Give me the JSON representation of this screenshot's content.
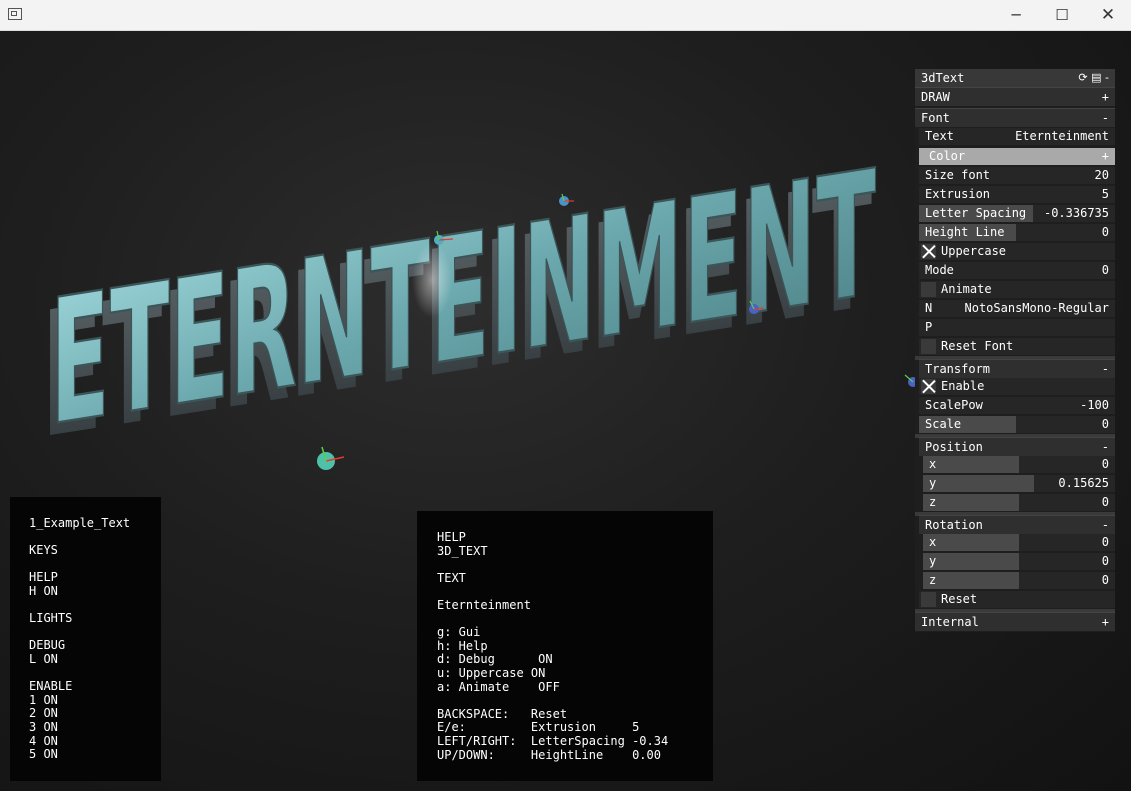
{
  "window": {
    "minimize_glyph": "─",
    "maximize_glyph": "☐",
    "close_glyph": "✕"
  },
  "left_panel": {
    "lines": [
      "1_Example_Text",
      "",
      "KEYS",
      "",
      "HELP",
      "H ON",
      "",
      "LIGHTS",
      "",
      "DEBUG",
      "L ON",
      "",
      "ENABLE",
      "1 ON",
      "2 ON",
      "3 ON",
      "4 ON",
      "5 ON"
    ]
  },
  "help_panel": {
    "lines": [
      "HELP",
      "3D_TEXT",
      "",
      "TEXT",
      "",
      "Eternteinment",
      "",
      "g: Gui",
      "h: Help",
      "d: Debug      ON",
      "u: Uppercase ON",
      "a: Animate    OFF",
      "",
      "BACKSPACE:   Reset",
      "E/e:         Extrusion     5",
      "LEFT/RIGHT:  LetterSpacing -0.34",
      "UP/DOWN:     HeightLine    0.00"
    ]
  },
  "scene": {
    "text_3d": "ETERNTEINMENT",
    "text_color": "#7ec0c4"
  },
  "gui": {
    "title": "3dText",
    "title_icons": "⟳ ▤ -",
    "draw": {
      "label": "DRAW",
      "toggle": "+"
    },
    "font": {
      "label": "Font",
      "toggle": "-",
      "text_label": "Text",
      "text_value": "Eternteinment",
      "color_label": "Color",
      "color_toggle": "+",
      "size_label": "Size font",
      "size_value": "20",
      "extrusion_label": "Extrusion",
      "extrusion_value": "5",
      "spacing_label": "Letter Spacing",
      "spacing_value": "-0.336735",
      "height_label": "Height Line",
      "height_value": "0",
      "uppercase_label": "Uppercase",
      "mode_label": "Mode",
      "mode_value": "0",
      "animate_label": "Animate",
      "n_label": "N",
      "n_value": "NotoSansMono-Regular",
      "p_label": "P",
      "reset_label": "Reset Font"
    },
    "transform": {
      "label": "Transform",
      "toggle": "-",
      "enable_label": "Enable",
      "scalepow_label": "ScalePow",
      "scalepow_value": "-100",
      "scale_label": "Scale",
      "scale_value": "0"
    },
    "position": {
      "label": "Position",
      "toggle": "-",
      "x_label": "x",
      "x_value": "0",
      "y_label": "y",
      "y_value": "0.15625",
      "z_label": "z",
      "z_value": "0"
    },
    "rotation": {
      "label": "Rotation",
      "toggle": "-",
      "x_label": "x",
      "x_value": "0",
      "y_label": "y",
      "y_value": "0",
      "z_label": "z",
      "z_value": "0"
    },
    "reset_label": "Reset",
    "internal": {
      "label": "Internal",
      "toggle": "+"
    }
  }
}
